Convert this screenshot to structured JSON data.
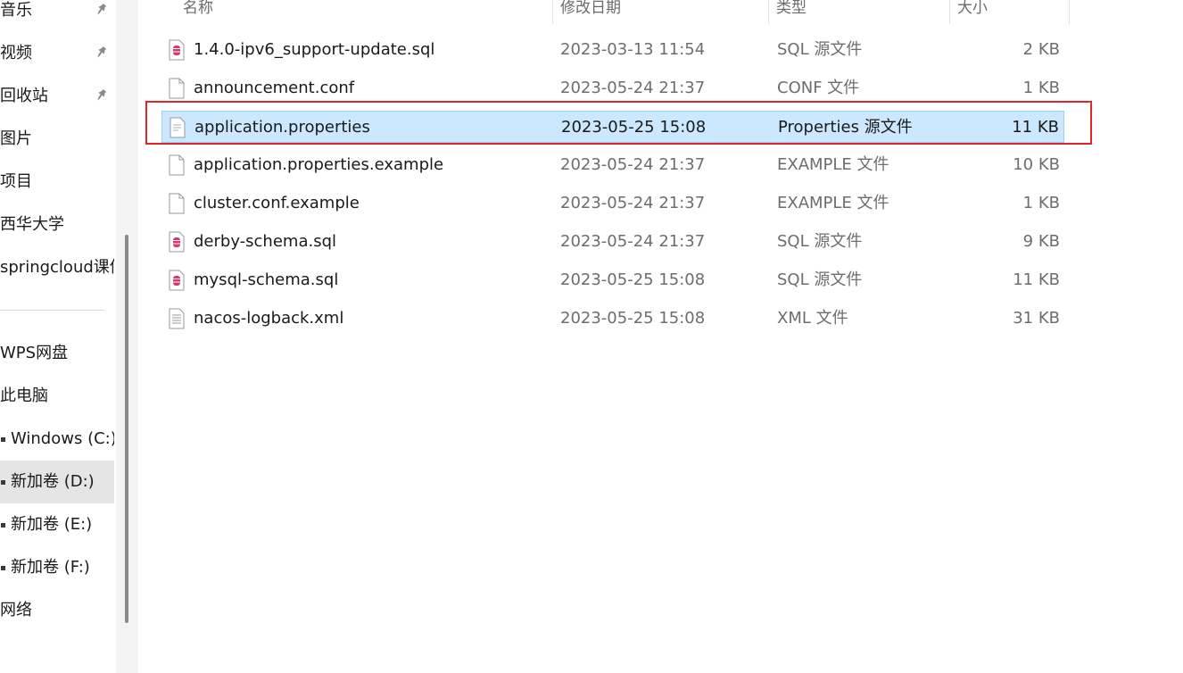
{
  "nav": {
    "items": [
      {
        "label": "音乐",
        "pinned": true,
        "icon": "pin-icon"
      },
      {
        "label": "视频",
        "pinned": true,
        "icon": "pin-icon"
      },
      {
        "label": "回收站",
        "pinned": true,
        "icon": "pin-icon"
      },
      {
        "label": "图片",
        "pinned": false
      },
      {
        "label": "项目",
        "pinned": false
      },
      {
        "label": "西华大学",
        "pinned": false
      },
      {
        "label": "springcloud课件",
        "pinned": false
      },
      {
        "label": "WPS网盘",
        "pinned": false
      },
      {
        "label": "此电脑",
        "pinned": false
      },
      {
        "label": "Windows (C:)",
        "pinned": false,
        "drive": true
      },
      {
        "label": "新加卷 (D:)",
        "pinned": false,
        "drive": true,
        "selected": true
      },
      {
        "label": "新加卷 (E:)",
        "pinned": false,
        "drive": true
      },
      {
        "label": "新加卷 (F:)",
        "pinned": false,
        "drive": true
      },
      {
        "label": "网络",
        "pinned": false
      }
    ]
  },
  "columns": {
    "name": "名称",
    "date": "修改日期",
    "type": "类型",
    "size": "大小"
  },
  "files": [
    {
      "name": "1.4.0-ipv6_support-update.sql",
      "date": "2023-03-13 11:54",
      "type": "SQL 源文件",
      "size": "2 KB",
      "icon": "sql-file-icon"
    },
    {
      "name": "announcement.conf",
      "date": "2023-05-24 21:37",
      "type": "CONF 文件",
      "size": "1 KB",
      "icon": "blank-file-icon"
    },
    {
      "name": "application.properties",
      "date": "2023-05-25 15:08",
      "type": "Properties 源文件",
      "size": "11 KB",
      "icon": "text-file-icon",
      "selected": true
    },
    {
      "name": "application.properties.example",
      "date": "2023-05-24 21:37",
      "type": "EXAMPLE 文件",
      "size": "10 KB",
      "icon": "blank-file-icon"
    },
    {
      "name": "cluster.conf.example",
      "date": "2023-05-24 21:37",
      "type": "EXAMPLE 文件",
      "size": "1 KB",
      "icon": "blank-file-icon"
    },
    {
      "name": "derby-schema.sql",
      "date": "2023-05-24 21:37",
      "type": "SQL 源文件",
      "size": "9 KB",
      "icon": "sql-file-icon"
    },
    {
      "name": "mysql-schema.sql",
      "date": "2023-05-25 15:08",
      "type": "SQL 源文件",
      "size": "11 KB",
      "icon": "sql-file-icon"
    },
    {
      "name": "nacos-logback.xml",
      "date": "2023-05-25 15:08",
      "type": "XML 文件",
      "size": "31 KB",
      "icon": "xml-file-icon"
    }
  ],
  "colors": {
    "selection_bg": "#cce8ff",
    "selection_border": "#99d1ff",
    "highlight_annotation": "#e0262b",
    "sql_icon_accent": "#d9376e"
  }
}
